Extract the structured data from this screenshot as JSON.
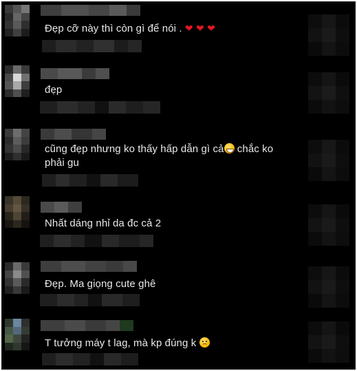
{
  "comments": [
    {
      "text": "Đẹp cỡ này thì còn gì để nói .",
      "reaction_icons": [
        "heart-icon",
        "heart-icon",
        "heart-icon"
      ]
    },
    {
      "text": "đẹp"
    },
    {
      "text_line1": "cũng đẹp nhưng ko thấy hấp dẫn gì cả",
      "emoji": "grinning-face-icon",
      "text_line1b": " chắc ko",
      "text_line2": "phải gu"
    },
    {
      "text": "Nhất dáng nhỉ da đc cả 2"
    },
    {
      "text": "Đẹp. Ma giọng cute ghê"
    },
    {
      "text": "T tưởng máy t lag, mà kp đúng k",
      "emoji": "sad-face-icon"
    }
  ],
  "colors": {
    "background": "#000000",
    "text": "#e8e8e8",
    "heart": "#e0171f"
  }
}
